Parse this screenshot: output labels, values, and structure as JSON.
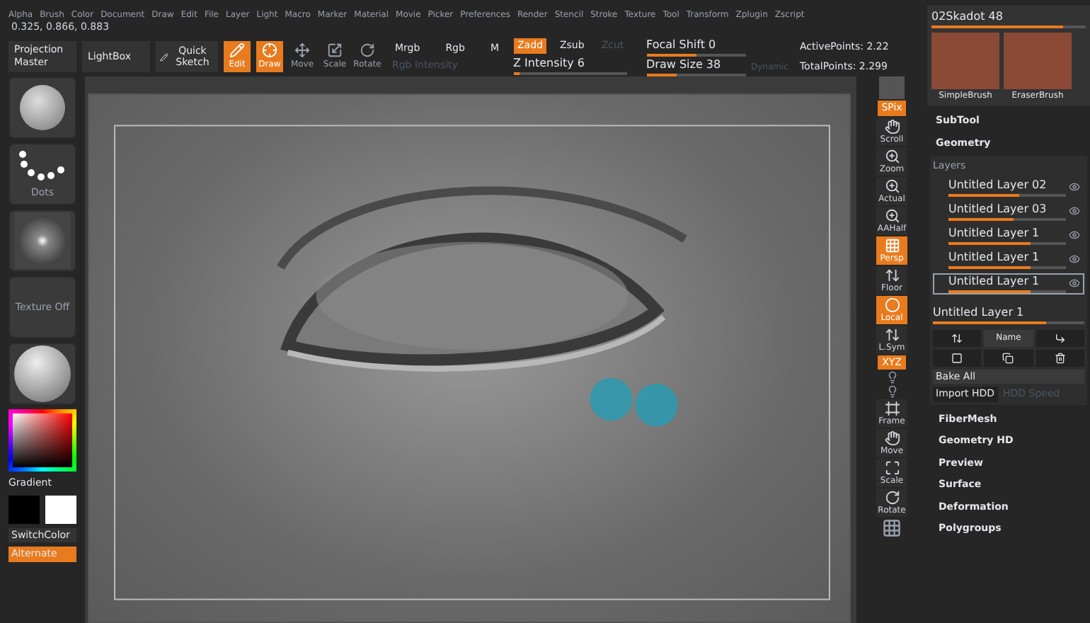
{
  "menu_bar": {
    "items": [
      "Alpha",
      "Brush",
      "Color",
      "Document",
      "Draw",
      "Edit",
      "File",
      "Layer",
      "Light",
      "Macro",
      "Marker",
      "Material",
      "Movie",
      "Picker",
      "Preferences",
      "Render",
      "Stencil",
      "Stroke",
      "Texture",
      "Tool",
      "Transform",
      "Zplugin",
      "Zscript"
    ]
  },
  "coordinates": "0.325, 0.866, 0.883",
  "toolbar": {
    "text_buttons": [
      "Projection Master",
      "LightBox"
    ],
    "quick_sketch": {
      "label": "Quick Sketch"
    },
    "modes": [
      {
        "label": "Edit",
        "kind": "edit",
        "selected": true
      },
      {
        "label": "Draw",
        "kind": "draw",
        "selected": true
      },
      {
        "label": "Move",
        "kind": "move",
        "selected": false
      },
      {
        "label": "Scale",
        "kind": "scale",
        "selected": false
      },
      {
        "label": "Rotate",
        "kind": "rotate",
        "selected": false
      }
    ],
    "color_modes": [
      {
        "label": "Mrgb",
        "selected": false
      },
      {
        "label": "Rgb",
        "selected": false
      },
      {
        "label": "M",
        "selected": false
      }
    ],
    "rgb_intensity": {
      "label": "Rgb Intensity",
      "disabled": true
    },
    "z_modes": [
      {
        "label": "Zadd",
        "selected": true,
        "disabled": false
      },
      {
        "label": "Zsub",
        "selected": false,
        "disabled": false
      },
      {
        "label": "Zcut",
        "selected": false,
        "disabled": true
      }
    ],
    "z_intensity": {
      "label": "Z Intensity 6",
      "level": 0.06
    },
    "focal_shift": {
      "label": "Focal Shift 0",
      "level": 0.5
    },
    "draw_size": {
      "label": "Draw Size 38",
      "level": 0.3
    },
    "dynamic": {
      "label": "Dynamic",
      "disabled": true
    },
    "stats": [
      "ActivePoints: 2.22",
      "TotalPoints: 2.299"
    ]
  },
  "left_panel": {
    "thumbnails": [
      {
        "kind": "brush"
      },
      {
        "kind": "stroke",
        "label": "Dots"
      },
      {
        "kind": "alpha"
      },
      {
        "kind": "texture",
        "label": "Texture Off"
      },
      {
        "kind": "material"
      }
    ],
    "gradient_label": "Gradient",
    "switch_color": "SwitchColor",
    "alternate": {
      "label": "Alternate",
      "on": true
    }
  },
  "right_toolbar": [
    {
      "kind": "render"
    },
    {
      "kind": "text",
      "label": "SPix",
      "on": true
    },
    {
      "kind": "hand",
      "label": "Scroll",
      "on": false
    },
    {
      "kind": "zoom",
      "label": "Zoom",
      "on": false
    },
    {
      "kind": "zoom",
      "label": "Actual",
      "on": false
    },
    {
      "kind": "zoom",
      "label": "AAHalf",
      "on": false
    },
    {
      "kind": "grid",
      "label": "Persp",
      "on": true
    },
    {
      "kind": "floor",
      "label": "Floor",
      "on": false
    },
    {
      "kind": "local",
      "label": "Local",
      "on": true
    },
    {
      "kind": "floor",
      "label": "L.Sym",
      "on": false
    },
    {
      "kind": "text",
      "label": "XYZ",
      "on": true
    },
    {
      "kind": "light"
    },
    {
      "kind": "light"
    },
    {
      "kind": "frame",
      "label": "Frame",
      "on": false
    },
    {
      "kind": "hand",
      "label": "Move",
      "on": false
    },
    {
      "kind": "scale",
      "label": "Scale",
      "on": false
    },
    {
      "kind": "rotate",
      "label": "Rotate",
      "on": false
    },
    {
      "kind": "polyf"
    }
  ],
  "right_panel": {
    "tool_slider": {
      "label": "02Skadot 48",
      "level": 0.85
    },
    "brushes": [
      "SimpleBrush",
      "EraserBrush"
    ],
    "sections_top": [
      "SubTool",
      "Geometry"
    ],
    "layers": {
      "title": "Layers",
      "items": [
        {
          "name": "Untitled Layer 02",
          "level": 0.6,
          "selected": false
        },
        {
          "name": "Untitled Layer 03",
          "level": 0.55,
          "selected": false
        },
        {
          "name": "Untitled Layer 1",
          "level": 0.7,
          "selected": false
        },
        {
          "name": "Untitled Layer 1",
          "level": 0.7,
          "selected": false
        },
        {
          "name": "Untitled Layer 1",
          "level": 0.7,
          "selected": true
        }
      ],
      "current": {
        "label": "Untitled Layer 1",
        "level": 0.75
      },
      "name_button": "Name",
      "bake_all": "Bake All",
      "import_hdd": "Import HDD",
      "hdd_speed": {
        "label": "HDD Speed",
        "disabled": true
      }
    },
    "sections": [
      "FiberMesh",
      "Geometry HD",
      "Preview",
      "Surface",
      "Deformation",
      "Polygroups"
    ]
  }
}
